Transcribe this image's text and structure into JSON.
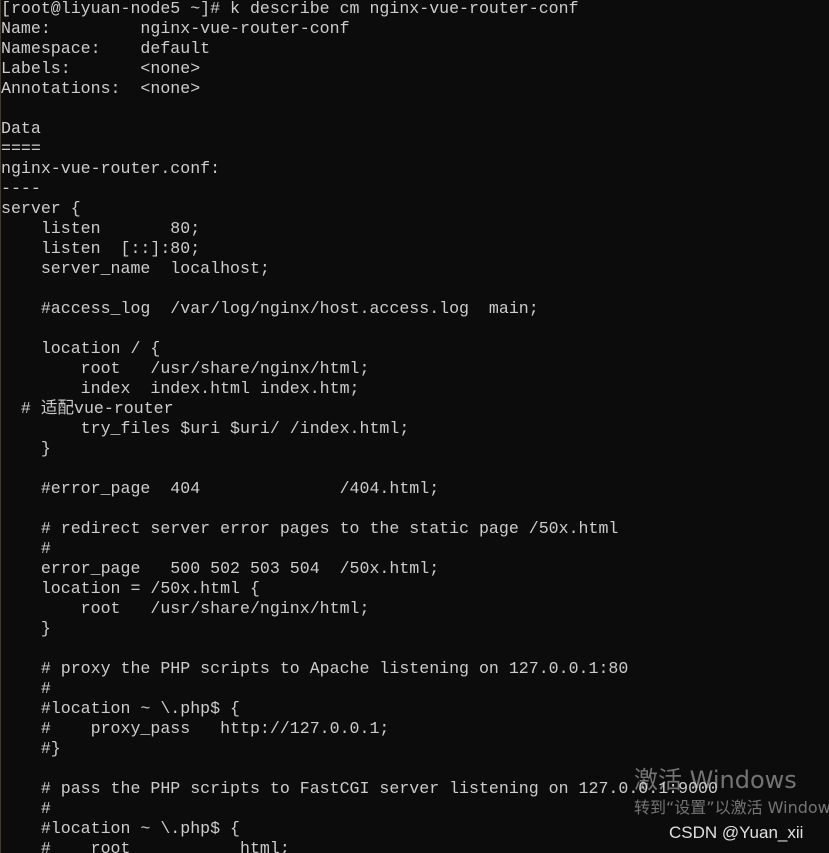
{
  "terminal": {
    "background": "#0c0c0c",
    "foreground": "#cccccc",
    "lines": [
      "[root@liyuan-node5 ~]# k describe cm nginx-vue-router-conf",
      "Name:         nginx-vue-router-conf",
      "Namespace:    default",
      "Labels:       <none>",
      "Annotations:  <none>",
      "",
      "Data",
      "====",
      "nginx-vue-router.conf:",
      "----",
      "server {",
      "    listen       80;",
      "    listen  [::]:80;",
      "    server_name  localhost;",
      "",
      "    #access_log  /var/log/nginx/host.access.log  main;",
      "",
      "    location / {",
      "        root   /usr/share/nginx/html;",
      "        index  index.html index.htm;",
      "  # 适配vue-router",
      "        try_files $uri $uri/ /index.html;",
      "    }",
      "",
      "    #error_page  404              /404.html;",
      "",
      "    # redirect server error pages to the static page /50x.html",
      "    #",
      "    error_page   500 502 503 504  /50x.html;",
      "    location = /50x.html {",
      "        root   /usr/share/nginx/html;",
      "    }",
      "",
      "    # proxy the PHP scripts to Apache listening on 127.0.0.1:80",
      "    #",
      "    #location ~ \\.php$ {",
      "    #    proxy_pass   http://127.0.0.1;",
      "    #}",
      "",
      "    # pass the PHP scripts to FastCGI server listening on 127.0.0.1:9000",
      "    #",
      "    #location ~ \\.php$ {",
      "    #    root           html;"
    ]
  },
  "overlay": {
    "activation_title": "激活 Windows",
    "activation_subtitle": "转到“设置”以激活 Windows。",
    "credit": "CSDN @Yuan_xii"
  }
}
